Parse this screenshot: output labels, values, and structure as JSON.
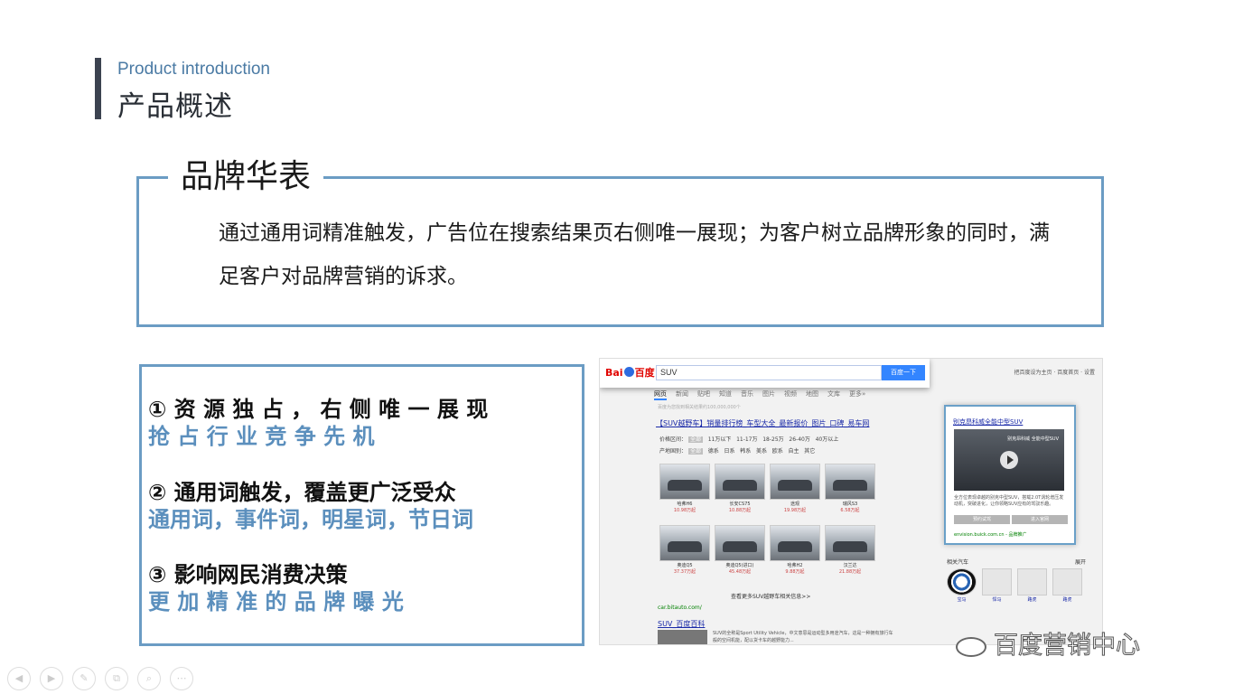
{
  "slide": {
    "subtitle_en": "Product introduction",
    "title_zh": "产品概述",
    "section_title": "品牌华表",
    "description": "通过通用词精准触发，广告位在搜索结果页右侧唯一展现；为客户树立品牌形象的同时，满足客户对品牌营销的诉求。"
  },
  "features": [
    {
      "head": "① 资 源 独 占 ， 右 侧 唯 一 展 现",
      "sub": "抢 占 行 业 竞 争 先 机"
    },
    {
      "head": "② 通用词触发，覆盖更广泛受众",
      "sub": "通用词，事件词，明星词，节日词"
    },
    {
      "head": "③ 影响网民消费决策",
      "sub": "更 加 精 准 的 品 牌 曝 光"
    }
  ],
  "screenshot": {
    "logo_bai": "Bai",
    "logo_du": "百度",
    "query": "SUV",
    "search_button": "百度一下",
    "top_right": "把百度设为主页 · 百度首页 · 设置",
    "tabs": [
      "网页",
      "新闻",
      "贴吧",
      "知道",
      "音乐",
      "图片",
      "视频",
      "地图",
      "文库",
      "更多»"
    ],
    "result_count_hint": "百度为您找到相关结果约100,000,000个",
    "result_title": "【SUV越野车】销量排行榜_车型大全_最新报价_图片_口碑_易车网",
    "filter_price_label": "价格区间：",
    "filter_price_selected": "全部",
    "filter_price": [
      "11万以下",
      "11-17万",
      "18-25万",
      "26-40万",
      "40万以上"
    ],
    "filter_origin_label": "产地国别：",
    "filter_origin_selected": "全部",
    "filter_origin": [
      "德系",
      "日系",
      "韩系",
      "美系",
      "欧系",
      "自主",
      "其它"
    ],
    "cars": [
      {
        "name": "哈弗H6",
        "price": "10.98万起"
      },
      {
        "name": "长安CS75",
        "price": "10.88万起"
      },
      {
        "name": "途观",
        "price": "19.98万起"
      },
      {
        "name": "瑞风S3",
        "price": "6.58万起"
      },
      {
        "name": "奥迪Q5",
        "price": "37.37万起"
      },
      {
        "name": "奥迪Q5(进口)",
        "price": "45.48万起"
      },
      {
        "name": "哈弗H2",
        "price": "9.88万起"
      },
      {
        "name": "汉兰达",
        "price": "21.88万起"
      }
    ],
    "more_link": "查看更多SUV越野车相关信息>>",
    "result_url": "car.bitauto.com/",
    "baike_title": "SUV_百度百科",
    "baike_desc": "SUV的全称是Sport Utility Vehicle，中文意思是运动型多用途汽车，这是一种拥有旅行车般的空间机能，配以货卡车的越野能力...",
    "ad": {
      "title": "别克昂科威全能中型SUV",
      "video_text": "别克昂科威 全能中型SUV",
      "desc": "全方位表现卓越的别克中型SUV，搭载2.0T涡轮增压发动机，突破进化，让你领略SUV应有的驾驭乐趣。",
      "btn_1": "预约试驾",
      "btn_2": "进入官网",
      "url": "envision.buick.com.cn - 品牌推广"
    },
    "related_heading": "相关汽车",
    "related_more": "展开",
    "related_brands": [
      "宝马",
      "悍马",
      "路虎",
      "路虎"
    ]
  },
  "watermark": "百度营销中心",
  "nav_buttons": [
    "◀",
    "▶",
    "✎",
    "⧉",
    "⌕",
    "⋯"
  ]
}
